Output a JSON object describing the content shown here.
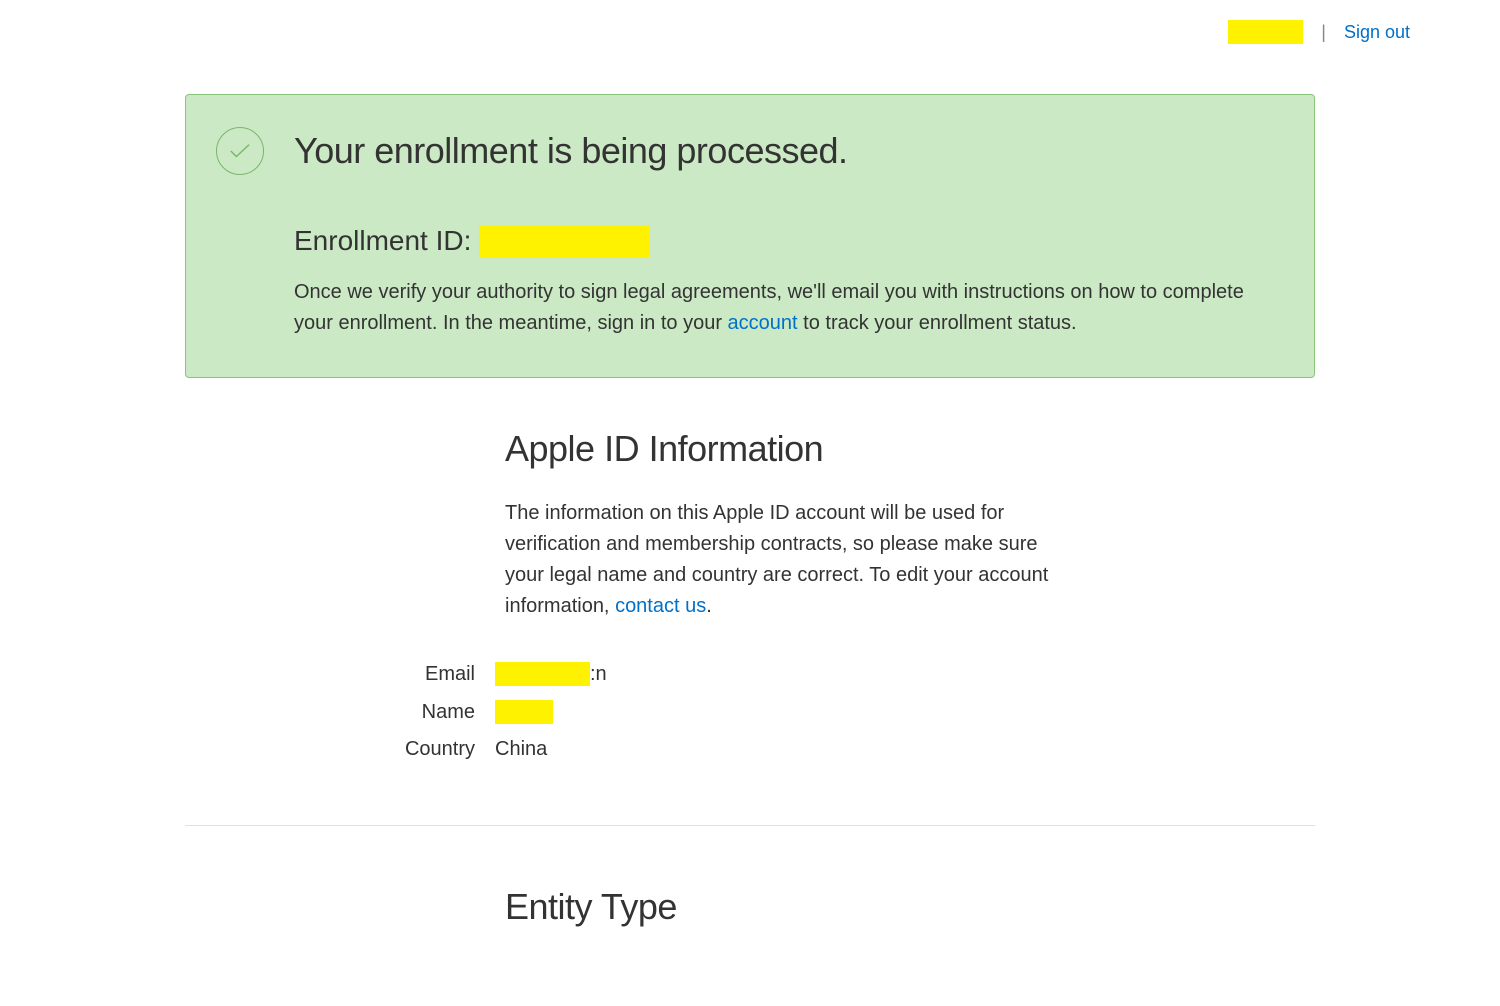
{
  "header": {
    "signout_label": "Sign out"
  },
  "banner": {
    "title": "Your enrollment is being processed.",
    "enrollment_label": "Enrollment ID:",
    "body_pre": "Once we verify your authority to sign legal agreements, we'll email you with instructions on how to complete your enrollment. In the meantime, sign in to your ",
    "account_link": "account",
    "body_post": " to track your enrollment status."
  },
  "apple_id": {
    "heading": "Apple ID Information",
    "desc_pre": "The information on this Apple ID account will be used for verification and membership contracts, so please make sure your legal name and country are correct. To edit your account information, ",
    "contact_link": "contact us",
    "desc_post": ".",
    "email_label": "Email",
    "email_suffix": ":n",
    "name_label": "Name",
    "country_label": "Country",
    "country_value": "China"
  },
  "entity_type": {
    "heading": "Entity Type"
  }
}
